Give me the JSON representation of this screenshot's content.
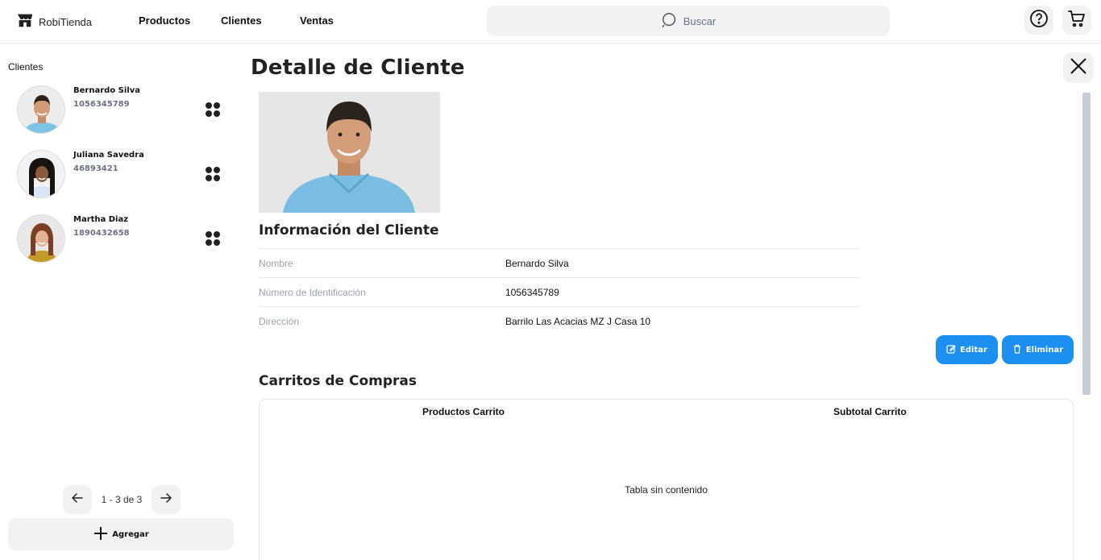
{
  "app": {
    "name": "RobiTienda"
  },
  "nav": {
    "items": [
      {
        "label": "Productos"
      },
      {
        "label": "Clientes"
      },
      {
        "label": "Ventas"
      }
    ]
  },
  "search": {
    "placeholder": "Buscar"
  },
  "sidebar": {
    "title": "Clientes",
    "clients": [
      {
        "name": "Bernardo Silva",
        "id": "1056345789"
      },
      {
        "name": "Juliana Savedra",
        "id": "46893421"
      },
      {
        "name": "Martha Diaz",
        "id": "1890432658"
      }
    ],
    "pagination": "1 - 3 de 3",
    "add_label": "Agregar"
  },
  "detail": {
    "title": "Detalle de Cliente",
    "info_title": "Información del Cliente",
    "fields": [
      {
        "label": "Nombre",
        "value": "Bernardo Silva"
      },
      {
        "label": "Número de Identificación",
        "value": "1056345789"
      },
      {
        "label": "Dirección",
        "value": "Barrilo Las Acacias MZ J Casa 10"
      }
    ],
    "edit_label": "Editar",
    "delete_label": "Eliminar",
    "carts_title": "Carritos de Compras",
    "cart_columns": [
      "Productos Carrito",
      "Subtotal Carrito"
    ],
    "empty_text": "Tabla sin contenido"
  },
  "colors": {
    "accent": "#1d8ff0",
    "surface": "#f0f2f4"
  },
  "icons": [
    "store-icon",
    "search-icon",
    "help-icon",
    "cart-icon",
    "close-icon",
    "grid-dots-icon",
    "arrow-left-icon",
    "arrow-right-icon",
    "plus-icon",
    "edit-icon",
    "trash-icon"
  ]
}
